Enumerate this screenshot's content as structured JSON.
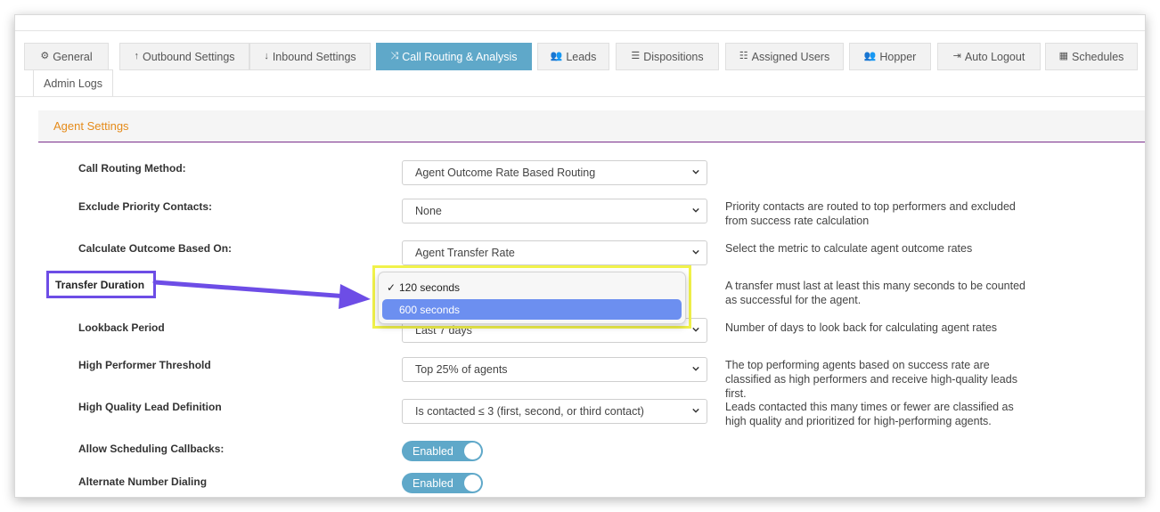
{
  "tabs": [
    {
      "label": "General",
      "icon": "gears-icon"
    },
    {
      "label": "Outbound Settings",
      "icon": "arrow-up-icon"
    },
    {
      "label": "Inbound Settings",
      "icon": "arrow-down-icon"
    },
    {
      "label": "Call Routing & Analysis",
      "icon": "shuffle-icon",
      "active": true
    },
    {
      "label": "Leads",
      "icon": "users-icon"
    },
    {
      "label": "Dispositions",
      "icon": "list-icon"
    },
    {
      "label": "Assigned Users",
      "icon": "list-ol-icon"
    },
    {
      "label": "Hopper",
      "icon": "users-icon"
    },
    {
      "label": "Auto Logout",
      "icon": "sign-out-icon"
    },
    {
      "label": "Schedules",
      "icon": "calendar-icon"
    },
    {
      "label": "Admin Logs",
      "icon": ""
    }
  ],
  "panel": {
    "title": "Agent Settings"
  },
  "fields": {
    "routing_method": {
      "label": "Call Routing Method:",
      "value": "Agent Outcome Rate Based Routing"
    },
    "exclude_priority": {
      "label": "Exclude Priority Contacts:",
      "value": "None",
      "help": "Priority contacts are routed to top performers and excluded from success rate calculation"
    },
    "calc_outcome": {
      "label": "Calculate Outcome Based On:",
      "value": "Agent Transfer Rate",
      "help": "Select the metric to calculate agent outcome rates"
    },
    "transfer_duration": {
      "label": "Transfer Duration",
      "help": "A transfer must last at least this many seconds to be counted as successful for the agent.",
      "options": [
        "120 seconds",
        "600 seconds"
      ],
      "selected": "120 seconds",
      "highlighted": "600 seconds"
    },
    "lookback": {
      "label": "Lookback Period",
      "value": "Last 7 days",
      "help": "Number of days to look back for calculating agent rates"
    },
    "high_perf": {
      "label": "High Performer Threshold",
      "value": "Top 25% of agents",
      "help": "The top performing agents based on success rate are classified as high performers and receive high-quality leads first."
    },
    "hq_lead": {
      "label": "High Quality Lead Definition",
      "value": "Is contacted ≤ 3 (first, second, or third contact)",
      "help": "Leads contacted this many times or fewer are classified as high quality and prioritized for high-performing agents."
    },
    "sched_callbacks": {
      "label": "Allow Scheduling Callbacks:",
      "value": "Enabled"
    },
    "alt_dialing": {
      "label": "Alternate Number Dialing",
      "value": "Enabled"
    }
  },
  "colors": {
    "accent": "#5fa8c9",
    "heading": "#e58b1a",
    "highlight_yellow": "#f1f24a",
    "callout_purple": "#6d4de6",
    "option_selected": "#6c8ff0"
  }
}
